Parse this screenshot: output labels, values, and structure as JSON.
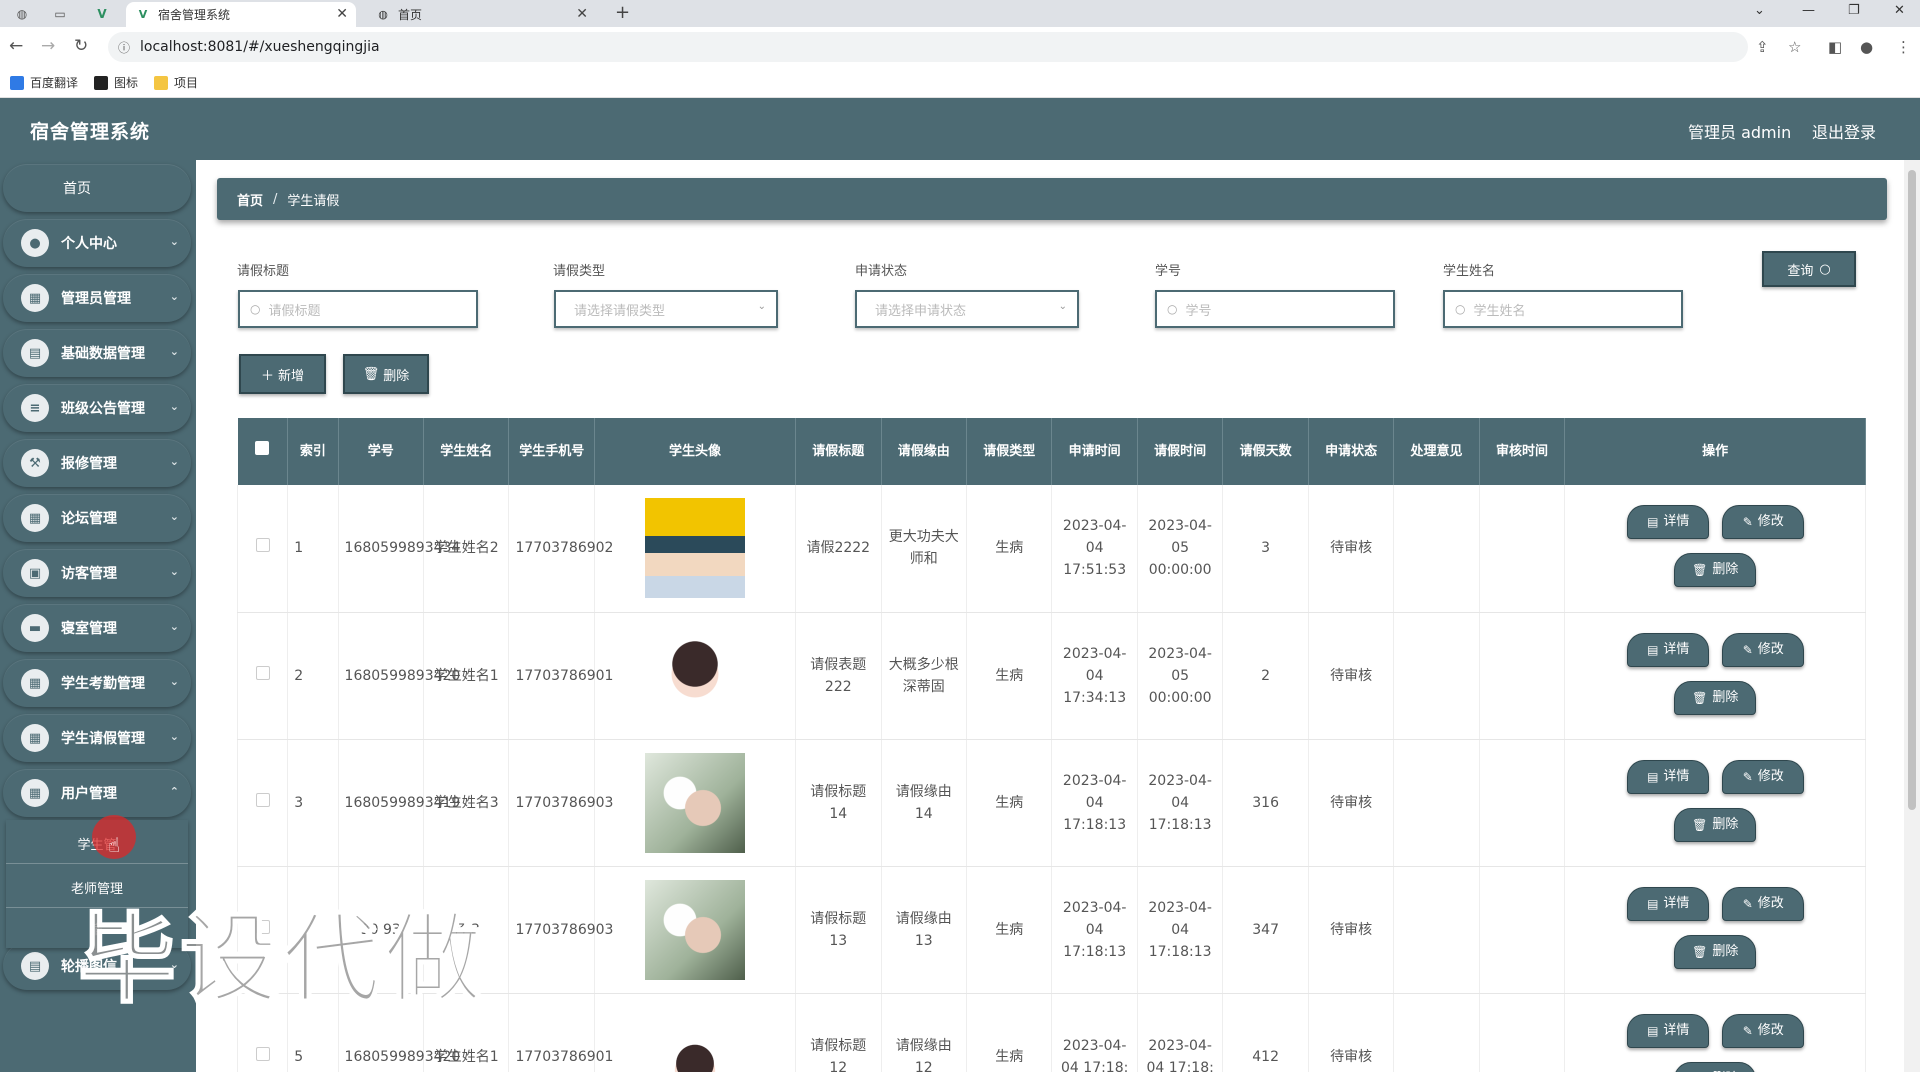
{
  "browser": {
    "tabs": [
      {
        "title": "宿舍管理系统",
        "active": true
      },
      {
        "title": "首页",
        "active": false
      }
    ],
    "url": "localhost:8081/#/xueshengqingjia",
    "bookmarks": [
      "百度翻译",
      "图标",
      "项目"
    ]
  },
  "header": {
    "app_title": "宿舍管理系统",
    "admin_label": "管理员 admin",
    "logout_label": "退出登录",
    "color": "#4c6a73"
  },
  "sidebar": {
    "home": "首页",
    "items": [
      {
        "label": "个人中心",
        "icon": "user-icon"
      },
      {
        "label": "管理员管理",
        "icon": "grid-icon"
      },
      {
        "label": "基础数据管理",
        "icon": "clipboard-icon"
      },
      {
        "label": "班级公告管理",
        "icon": "list-icon"
      },
      {
        "label": "报修管理",
        "icon": "tools-icon"
      },
      {
        "label": "论坛管理",
        "icon": "grid-icon"
      },
      {
        "label": "访客管理",
        "icon": "chat-icon"
      },
      {
        "label": "寝室管理",
        "icon": "bed-icon"
      },
      {
        "label": "学生考勤管理",
        "icon": "grid-icon"
      },
      {
        "label": "学生请假管理",
        "icon": "grid-icon"
      },
      {
        "label": "用户管理",
        "icon": "grid-icon"
      },
      {
        "label": "轮播图信",
        "icon": "clipboard-icon"
      }
    ],
    "submenu": [
      "学生管",
      "老师管理",
      "宿"
    ]
  },
  "breadcrumb": {
    "home": "首页",
    "separator": "/",
    "current": "学生请假"
  },
  "filters": {
    "title": {
      "label": "请假标题",
      "placeholder": "请假标题"
    },
    "type": {
      "label": "请假类型",
      "placeholder": "请选择请假类型"
    },
    "status": {
      "label": "申请状态",
      "placeholder": "请选择申请状态"
    },
    "student_no": {
      "label": "学号",
      "placeholder": "学号"
    },
    "student_name": {
      "label": "学生姓名",
      "placeholder": "学生姓名"
    },
    "query_button": "查询"
  },
  "actions": {
    "add": "新增",
    "delete": "删除"
  },
  "table": {
    "headers": [
      "索引",
      "学号",
      "学生姓名",
      "学生手机号",
      "学生头像",
      "请假标题",
      "请假缘由",
      "请假类型",
      "申请时间",
      "请假时间",
      "请假天数",
      "申请状态",
      "处理意见",
      "审核时间",
      "操作"
    ],
    "op_labels": {
      "detail": "详情",
      "edit": "修改",
      "delete": "删除"
    },
    "rows": [
      {
        "index": "1",
        "student_no": "1680599893434",
        "name": "学生姓名2",
        "phone": "17703786902",
        "avatar": "cartoon-boy-yellow-hat",
        "title": "请假2222",
        "reason": "更大功夫大师和",
        "type": "生病",
        "apply_time": "2023-04-04 17:51:53",
        "leave_time": "2023-04-05 00:00:00",
        "days": "3",
        "status": "待审核",
        "opinion": "",
        "review_time": ""
      },
      {
        "index": "2",
        "student_no": "1680599893420",
        "name": "学生姓名1",
        "phone": "17703786901",
        "avatar": "cartoon-girl",
        "title": "请假表题222",
        "reason": "大概多少根深蒂固",
        "type": "生病",
        "apply_time": "2023-04-04 17:34:13",
        "leave_time": "2023-04-05 00:00:00",
        "days": "2",
        "status": "待审核",
        "opinion": "",
        "review_time": ""
      },
      {
        "index": "3",
        "student_no": "1680599893419",
        "name": "学生姓名3",
        "phone": "17703786903",
        "avatar": "photo-flowers",
        "title": "请假标题14",
        "reason": "请假缘由14",
        "type": "生病",
        "apply_time": "2023-04-04 17:18:13",
        "leave_time": "2023-04-04 17:18:13",
        "days": "316",
        "status": "待审核",
        "opinion": "",
        "review_time": ""
      },
      {
        "index": "",
        "student_no": "30 93",
        "name": "名 3",
        "phone": "17703786903",
        "avatar": "photo-flowers",
        "title": "请假标题13",
        "reason": "请假缘由13",
        "type": "生病",
        "apply_time": "2023-04-04 17:18:13",
        "leave_time": "2023-04-04 17:18:13",
        "days": "347",
        "status": "待审核",
        "opinion": "",
        "review_time": ""
      },
      {
        "index": "5",
        "student_no": "1680599893420",
        "name": "学生姓名1",
        "phone": "17703786901",
        "avatar": "cartoon-girl",
        "title": "请假标题12",
        "reason": "请假缘由12",
        "type": "生病",
        "apply_time": "2023-04-04 17:18:",
        "leave_time": "2023-04-04 17:18:",
        "days": "412",
        "status": "待审核",
        "opinion": "",
        "review_time": ""
      }
    ]
  },
  "watermark": "毕设代做"
}
